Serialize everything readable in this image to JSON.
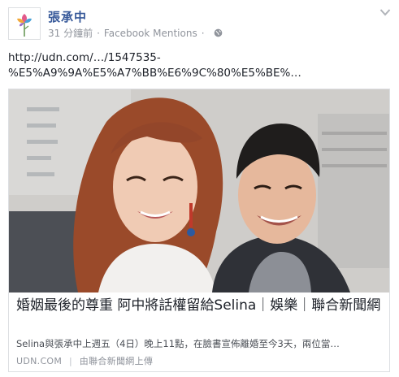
{
  "post": {
    "author": "張承中",
    "timestamp": "31 分鐘前",
    "separator": "·",
    "app": "Facebook Mentions",
    "privacy_icon": "globe-icon",
    "menu_icon": "chevron-down-icon",
    "link_text_line1": "http://udn.com/…/1547535-",
    "link_text_line2": "%E5%A9%9A%E5%A7%BB%E6%9C%80%E5%BE%…"
  },
  "link_card": {
    "image_description_icon": "photo",
    "title": "婚姻最後的尊重 阿中將話權留給Selina｜娛樂｜聯合新聞網",
    "description": "Selina與張承中上週五（4日）晚上11點，在臉書宣佈離婚至今3天，兩位當…",
    "domain": "UDN.COM",
    "divider": "|",
    "uploader": "由聯合新聞網上傳"
  },
  "colors": {
    "author_link": "#365899",
    "meta_text": "#90949c",
    "border": "#dddfe2"
  }
}
